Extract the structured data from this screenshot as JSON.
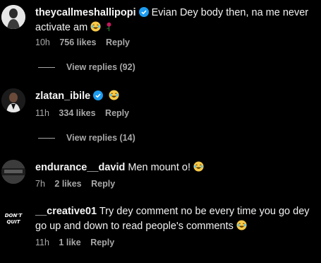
{
  "comments": [
    {
      "username": "theycallmeshallipopi",
      "verified": true,
      "text": "Evian Dey body then, na me never activate am",
      "emojis": [
        "laughing-emoji",
        "rose-emoji"
      ],
      "time": "10h",
      "likes": "756 likes",
      "reply": "Reply",
      "view_replies": "View replies (92)"
    },
    {
      "username": "zlatan_ibile",
      "verified": true,
      "text": "",
      "emojis": [
        "laughing-emoji"
      ],
      "time": "11h",
      "likes": "334 likes",
      "reply": "Reply",
      "view_replies": "View replies (14)"
    },
    {
      "username": "endurance__david",
      "verified": false,
      "text": "Men mount o!",
      "emojis": [
        "laughing-emoji"
      ],
      "time": "7h",
      "likes": "2 likes",
      "reply": "Reply"
    },
    {
      "username": "__creative01",
      "verified": false,
      "text": "Try dey comment no be every time you go dey go up and down to read people's comments",
      "emojis": [
        "laughing-emoji"
      ],
      "time": "11h",
      "likes": "1 like",
      "reply": "Reply",
      "avatar_text": "DON'T QUIT"
    }
  ],
  "colors": {
    "background": "#000000",
    "text": "#f5f5f5",
    "muted": "#a8a8a8",
    "verified": "#1d9bf0"
  }
}
